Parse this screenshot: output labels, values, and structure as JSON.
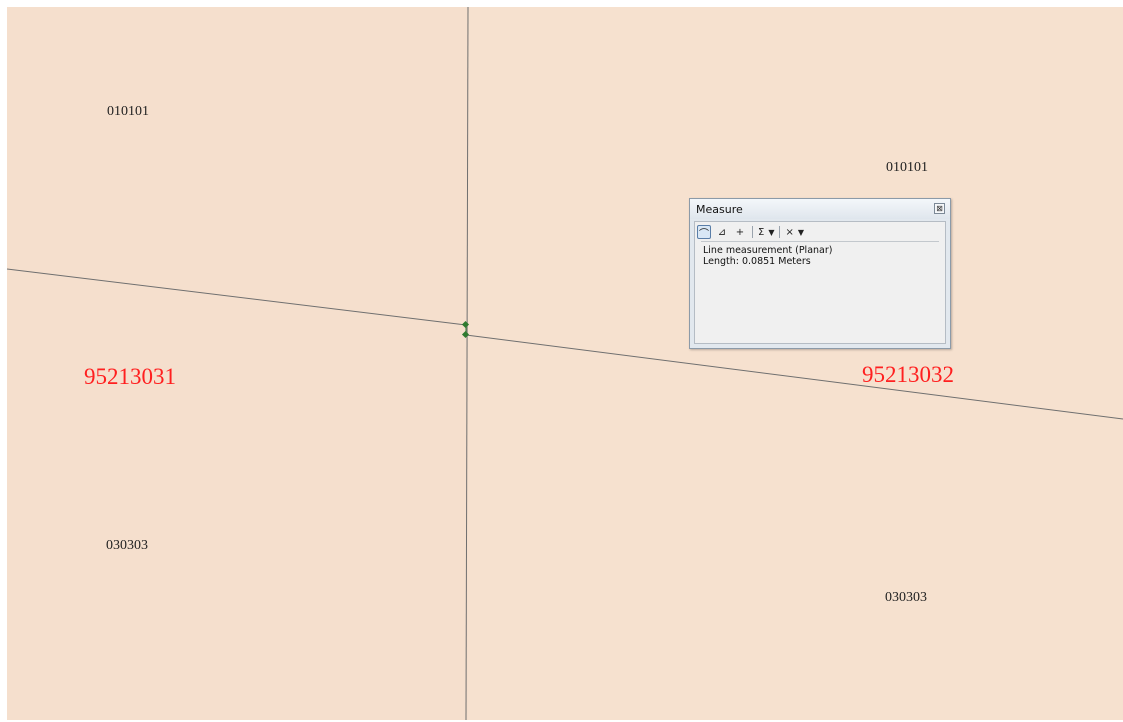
{
  "map": {
    "parcel_fill": "#f6e1cf",
    "left_parcel_fill": "#f5dfcd",
    "line_color": "#6f6f6f",
    "vertex_color": "#2f7a2f",
    "code_labels": [
      "010101",
      "010101",
      "030303",
      "030303"
    ],
    "parcel_labels": [
      "95213031",
      "95213032"
    ],
    "parcel_label_color": "#ff1f1f"
  },
  "measure_window": {
    "title": "Measure",
    "close_glyph": "⊠",
    "toolbar": {
      "line_tool_glyph": "⌒",
      "area_tool_glyph": "⊿",
      "feature_tool_glyph": "+",
      "sum_glyph": "Σ",
      "dropdown_glyph": "▼",
      "clear_glyph": "×"
    },
    "result_lines": [
      "Line measurement (Planar)",
      "Length: 0.0851 Meters"
    ]
  }
}
